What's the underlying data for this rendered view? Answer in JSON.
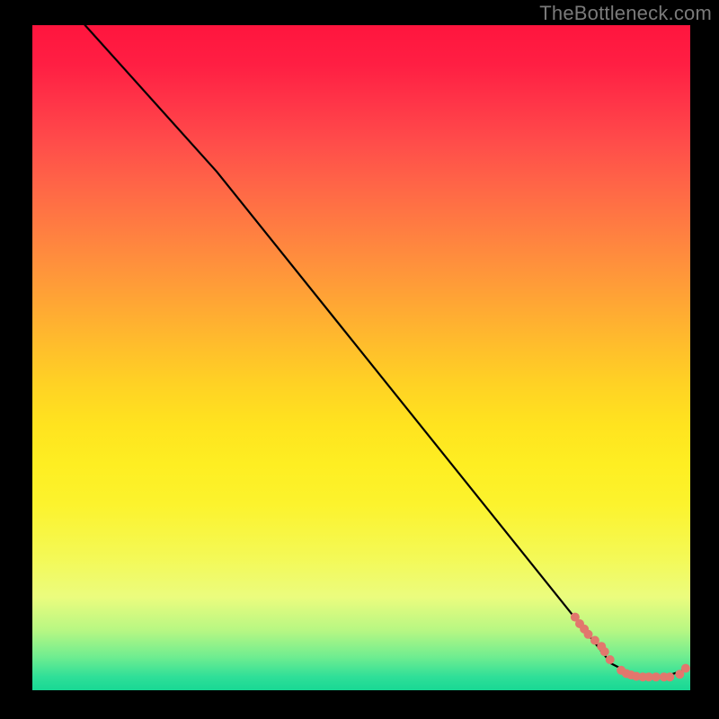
{
  "watermark": "TheBottleneck.com",
  "chart_data": {
    "type": "line",
    "title": "",
    "xlabel": "",
    "ylabel": "",
    "xlim": [
      0,
      100
    ],
    "ylim": [
      0,
      100
    ],
    "grid": false,
    "legend": false,
    "note": "Axes carry no printed ticks or labels; values are normalized to 0–100 in each dimension based on the plotted-area bounding box.",
    "series": [
      {
        "name": "bottleneck-curve",
        "style": "line",
        "color": "#000000",
        "x": [
          8,
          28,
          84,
          88,
          92,
          96,
          99
        ],
        "y": [
          100,
          78,
          9,
          4,
          2,
          2,
          3
        ]
      },
      {
        "name": "data-points",
        "style": "scatter",
        "color": "#e2776d",
        "x": [
          82.5,
          83.2,
          83.9,
          84.5,
          85.5,
          86.5,
          87.0,
          87.8,
          89.5,
          90.3,
          91.0,
          91.8,
          92.8,
          93.7,
          94.8,
          96.0,
          96.9,
          98.4,
          99.3
        ],
        "y": [
          11.0,
          10.0,
          9.2,
          8.4,
          7.5,
          6.6,
          5.8,
          4.6,
          3.0,
          2.5,
          2.3,
          2.1,
          2.0,
          2.0,
          2.0,
          2.0,
          2.0,
          2.4,
          3.3
        ]
      }
    ],
    "gradient_stops": [
      {
        "pos": 0.0,
        "color": "#ff153e"
      },
      {
        "pos": 0.25,
        "color": "#ff7b42"
      },
      {
        "pos": 0.5,
        "color": "#ffd224"
      },
      {
        "pos": 0.75,
        "color": "#f4f956"
      },
      {
        "pos": 0.92,
        "color": "#b7f783"
      },
      {
        "pos": 1.0,
        "color": "#18d894"
      }
    ]
  }
}
